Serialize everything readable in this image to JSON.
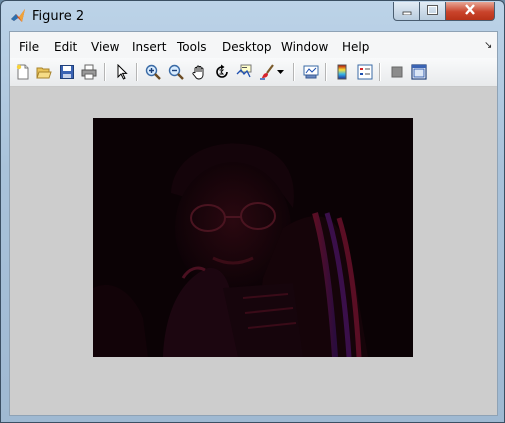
{
  "window": {
    "title": "Figure 2"
  },
  "menubar": {
    "items": [
      "File",
      "Edit",
      "View",
      "Insert",
      "Tools",
      "Desktop",
      "Window",
      "Help"
    ]
  },
  "toolbar": {
    "icons": [
      "new-figure-icon",
      "open-file-icon",
      "save-icon",
      "print-icon",
      "edit-plot-arrow-icon",
      "zoom-in-icon",
      "zoom-out-icon",
      "pan-hand-icon",
      "rotate-3d-icon",
      "data-cursor-icon",
      "brush-icon",
      "brush-dropdown-icon",
      "link-plot-icon",
      "colorbar-icon",
      "legend-icon",
      "hide-plot-tools-icon",
      "show-plot-tools-icon"
    ]
  },
  "figure": {
    "image": "dark-red-person-photo"
  }
}
